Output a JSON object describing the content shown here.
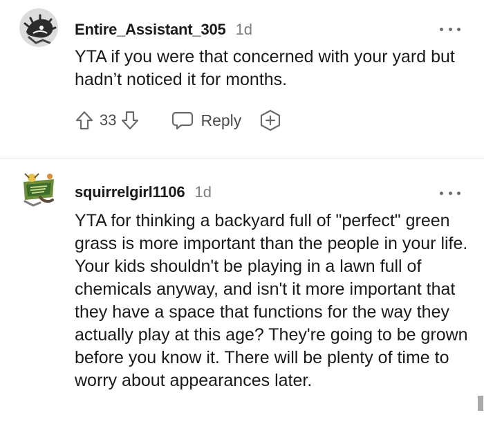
{
  "comments": [
    {
      "username": "Entire_Assistant_305",
      "time": "1d",
      "body": "YTA if you were that concerned with your yard but hadn’t noticed it for months.",
      "votes": "33",
      "reply_label": "Reply",
      "avatar_icon": "snoo-avatar-icon"
    },
    {
      "username": "squirrelgirl1106",
      "time": "1d",
      "body": "YTA for thinking a backyard full of \"perfect\" green grass is more important than the people in your life. Your kids shouldn't be playing in a lawn full of chemicals anyway, and isn't it more important that they have a space that functions for the way they actually play at this age? They're going to be grown before you know it. There will be plenty of time to worry about appearances later.",
      "avatar_icon": "snoo-avatar-icon"
    }
  ],
  "colors": {
    "text": "#1a1a1b",
    "meta": "#7c7c7c",
    "icon": "#6a6a6a",
    "divider": "#e3e3e3"
  }
}
